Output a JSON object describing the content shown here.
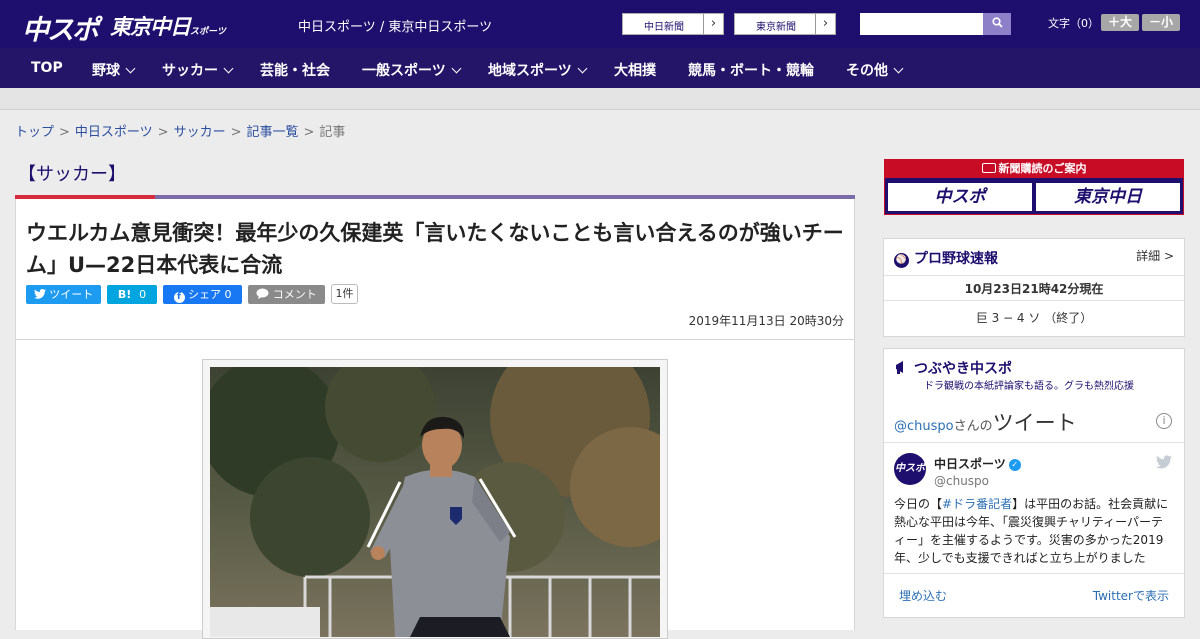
{
  "header": {
    "logo_chuspo": "中スポ",
    "logo_tokyo": "東京中日",
    "logo_tokyo_small": "スポーツ",
    "site_title": "中日スポーツ / 東京中日スポーツ",
    "paper_links": [
      "中日新聞",
      "東京新聞"
    ],
    "search_placeholder": "",
    "font_size_label": "文字（0）",
    "font_bigger": "＋大",
    "font_smaller": "－小"
  },
  "nav": {
    "items": [
      {
        "label": "TOP",
        "dropdown": false
      },
      {
        "label": "野球",
        "dropdown": true
      },
      {
        "label": "サッカー",
        "dropdown": true
      },
      {
        "label": "芸能・社会",
        "dropdown": false
      },
      {
        "label": "一般スポーツ",
        "dropdown": true
      },
      {
        "label": "地域スポーツ",
        "dropdown": true
      },
      {
        "label": "大相撲",
        "dropdown": false
      },
      {
        "label": "競馬・ボート・競輪",
        "dropdown": false
      },
      {
        "label": "その他",
        "dropdown": true
      }
    ]
  },
  "breadcrumb": {
    "items": [
      "トップ",
      "中日スポーツ",
      "サッカー",
      "記事一覧"
    ],
    "current": "記事",
    "separator": ">"
  },
  "article": {
    "category": "【サッカー】",
    "headline": "ウエルカム意見衝突！最年少の久保建英「言いたくないことも言い合えるのが強いチーム」U—22日本代表に合流",
    "share": {
      "tweet": "ツイート",
      "hatena_label": "B!",
      "hatena_count": "0",
      "facebook": "シェア 0",
      "comment": "コメント",
      "comment_count": "1件"
    },
    "date": "2019年11月13日 20時30分"
  },
  "sidebar": {
    "subscribe_title": "新聞購読のご案内",
    "subscribe_logos": [
      "中スポ",
      "東京中日"
    ],
    "baseball": {
      "title": "プロ野球速報",
      "detail": "詳細 >",
      "timestamp": "10月23日21時42分現在",
      "score": "巨 3 − 4 ソ （終了）"
    },
    "tweets": {
      "title": "つぶやき中スポ",
      "subtitle": "ドラ観戦の本紙評論家も語る。グラも熱烈応援",
      "handle_prefix": "@chuspo",
      "handle_suffix": "さんの",
      "tweets_word": "ツイート",
      "account_name": "中日スポーツ",
      "account_handle": "@chuspo",
      "tweet_before": "今日の【",
      "tweet_hashtag": "#ドラ番記者",
      "tweet_after": "】は平田のお話。社会貢献に熱心な平田は今年、「震災復興チャリティーパーティー」を主催するようです。災害の多かった2019年、少しでも支援できればと立ち上がりました",
      "embed": "埋め込む",
      "view_on_twitter": "Twitterで表示"
    }
  },
  "colors": {
    "header_bg": "#1e0f6e",
    "nav_bg": "#241568",
    "accent_red": "#d62b3c",
    "twitter_blue": "#1d9bf0",
    "hatena_blue": "#00a4de",
    "facebook_blue": "#1877f2"
  }
}
